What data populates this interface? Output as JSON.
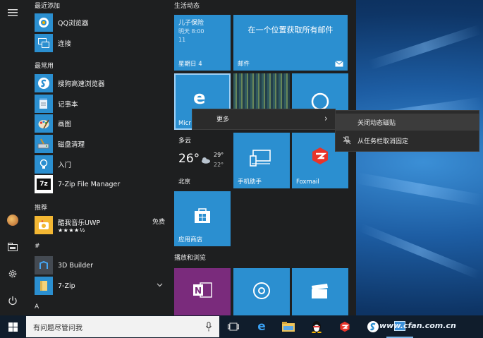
{
  "sidebar": {
    "recent_header": "最近添加",
    "frequent_header": "最常用",
    "recommend_header": "推荐",
    "hash_header": "#",
    "a_header": "A"
  },
  "recent_apps": [
    {
      "label": "QQ浏览器"
    },
    {
      "label": "连接"
    }
  ],
  "frequent_apps": [
    {
      "label": "搜狗高速浏览器"
    },
    {
      "label": "记事本"
    },
    {
      "label": "画图"
    },
    {
      "label": "磁盘清理"
    },
    {
      "label": "入门"
    },
    {
      "label": "7-Zip File Manager"
    }
  ],
  "recommended": {
    "label": "酷我音乐UWP",
    "badge": "免费",
    "stars": "★★★★½"
  },
  "hash_apps": [
    {
      "label": "3D Builder"
    },
    {
      "label": "7-Zip"
    }
  ],
  "tiles": {
    "group1_title": "生活动态",
    "group2_title": "播放和浏览",
    "calendar": {
      "line1": "儿子保险",
      "line2": "明天 8:00",
      "line3": "11",
      "label": "星期日 4"
    },
    "mail": {
      "text": "在一个位置获取所有邮件",
      "label": "邮件"
    },
    "edge": {
      "label": "Micr"
    },
    "weather": {
      "condition": "多云",
      "temp": "26°",
      "high": "29°",
      "low": "22°",
      "city": "北京"
    },
    "phone": {
      "label": "手机助手"
    },
    "foxmail": {
      "label": "Foxmail"
    },
    "store": {
      "label": "应用商店"
    }
  },
  "context_menu": {
    "more": "更多",
    "more_arrow": "›",
    "close_live_tile": "关闭动态磁贴",
    "unpin_taskbar": "从任务栏取消固定"
  },
  "taskbar": {
    "search_placeholder": "有问题尽管问我",
    "watermark": "www.cfan.com.cn"
  },
  "colors": {
    "accent": "#2b8fd0",
    "menu_bg": "#1e1f20",
    "onenote": "#7a2b7c"
  }
}
